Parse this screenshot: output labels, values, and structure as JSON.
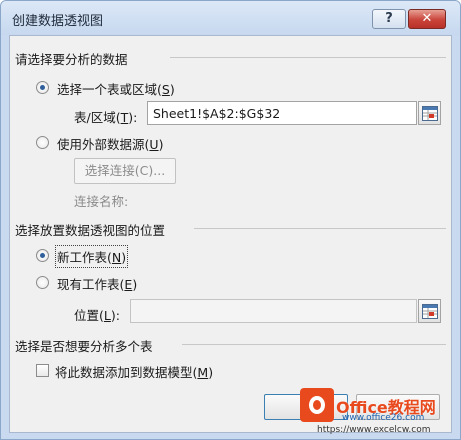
{
  "window": {
    "title": "创建数据透视图",
    "help_label": "?",
    "close_label": "✕"
  },
  "data_source": {
    "section_label": "请选择要分析的数据",
    "select_table": {
      "label": "选择一个表或区域",
      "hotkey": "S",
      "checked": true
    },
    "range": {
      "label": "表/区域",
      "hotkey": "T",
      "value": "Sheet1!$A$2:$G$32"
    },
    "external": {
      "label": "使用外部数据源",
      "hotkey": "U",
      "checked": false
    },
    "choose_connection": {
      "label": "选择连接(C)..."
    },
    "connection_name": {
      "label": "连接名称:"
    }
  },
  "placement": {
    "section_label": "选择放置数据透视图的位置",
    "new_sheet": {
      "label": "新工作表",
      "hotkey": "N",
      "checked": true
    },
    "existing_sheet": {
      "label": "现有工作表",
      "hotkey": "E",
      "checked": false
    },
    "location": {
      "label": "位置",
      "hotkey": "L",
      "value": ""
    }
  },
  "multi_table": {
    "section_label": "选择是否想要分析多个表",
    "add_to_model": {
      "label": "将此数据添加到数据模型",
      "hotkey": "M",
      "checked": false
    }
  },
  "buttons": {
    "ok_label": "确"
  },
  "watermark": {
    "brand": "Office教程网",
    "url1": "www.office26.com",
    "url2": "https://www.excelcw.com"
  }
}
